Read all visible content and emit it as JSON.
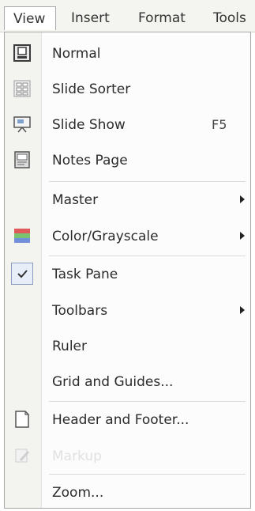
{
  "menubar": {
    "view": "View",
    "insert": "Insert",
    "format": "Format",
    "tools": "Tools"
  },
  "menu": {
    "normal": "Normal",
    "slide_sorter": "Slide Sorter",
    "slide_show": "Slide Show",
    "slide_show_shortcut": "F5",
    "notes_page": "Notes Page",
    "master": "Master",
    "color_grayscale": "Color/Grayscale",
    "task_pane": "Task Pane",
    "toolbars": "Toolbars",
    "ruler": "Ruler",
    "grid_and_guides": "Grid and Guides...",
    "header_and_footer": "Header and Footer...",
    "markup": "Markup",
    "zoom": "Zoom..."
  },
  "icons": {
    "normal": "normal-view-icon",
    "slide_sorter": "slide-sorter-icon",
    "slide_show": "slide-show-icon",
    "notes_page": "notes-page-icon",
    "color_grayscale": "color-grayscale-icon",
    "task_pane": "checkmark-icon",
    "header_and_footer": "header-footer-icon",
    "markup": "markup-icon",
    "submenu_arrow": "submenu-arrow-icon"
  },
  "colors": {
    "gutter": "#f3f3ef",
    "checked_box": "#e8eef8",
    "disabled_text": "#e1e1e1"
  }
}
